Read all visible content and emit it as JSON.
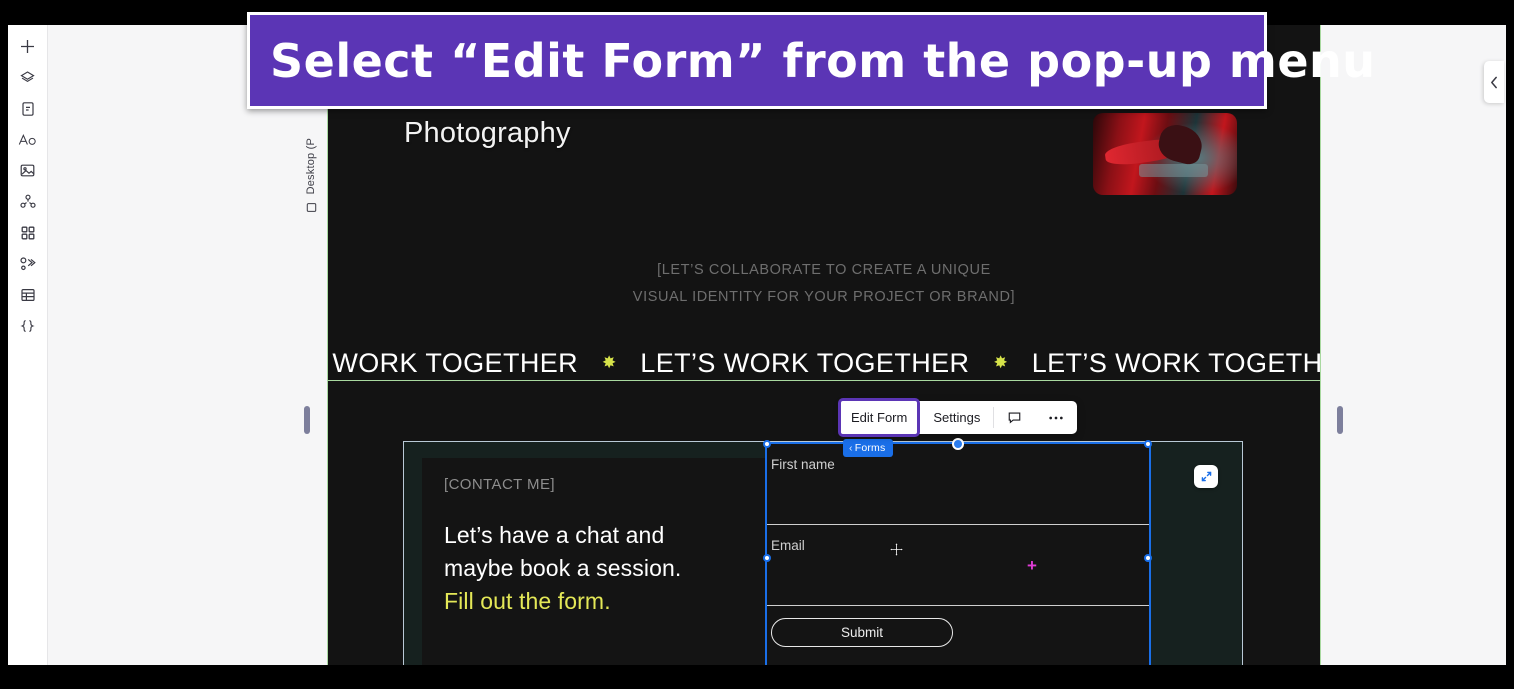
{
  "banner": {
    "text": "Select “Edit Form” from the pop-up menu"
  },
  "rail": {
    "items": [
      {
        "name": "add-icon",
        "label": "Add"
      },
      {
        "name": "layers-icon",
        "label": "Layers"
      },
      {
        "name": "page-icon",
        "label": "Pages"
      },
      {
        "name": "text-icon",
        "label": "Text"
      },
      {
        "name": "media-icon",
        "label": "Media"
      },
      {
        "name": "sections-icon",
        "label": "Sections"
      },
      {
        "name": "apps-icon",
        "label": "Apps"
      },
      {
        "name": "automation-icon",
        "label": "Automations"
      },
      {
        "name": "cms-icon",
        "label": "CMS"
      },
      {
        "name": "code-icon",
        "label": "Dev Mode"
      }
    ]
  },
  "device": {
    "label": "Desktop (P"
  },
  "collapse_tab": {
    "icon": "chevron-left-icon"
  },
  "toolbar": {
    "edit_form_label": "Edit Form",
    "settings_label": "Settings",
    "comment_icon": "comment-icon",
    "more_icon": "more-options-icon",
    "highlight_color": "#5b35b5"
  },
  "forms_badge": {
    "chevron": "‹",
    "label": "Forms",
    "color": "#1a6fe8"
  },
  "canvas": {
    "site_title": "Photography",
    "collab_line_1": "[LET’S COLLABORATE TO CREATE A UNIQUE",
    "collab_line_2": "VISUAL IDENTITY FOR YOUR PROJECT OR BRAND]",
    "marquee": {
      "word": "LET’S WORK TOGETHER",
      "separator": "✸",
      "separator_color": "#d6e34a",
      "repeats": 3
    }
  },
  "contact": {
    "eyebrow": "[CONTACT ME]",
    "headline_line_1": "Let’s have a chat and",
    "headline_line_2": "maybe book a session.",
    "headline_accent": "Fill out the form.",
    "accent_color": "#e4e857"
  },
  "form": {
    "fields": [
      {
        "label": "First name"
      },
      {
        "label": "Email"
      }
    ],
    "submit_label": "Submit",
    "expand_icon": "expand-arrows-icon",
    "selection_color": "#1a6fe8",
    "add_marker": "+",
    "add_marker_color": "#e03cd6"
  }
}
